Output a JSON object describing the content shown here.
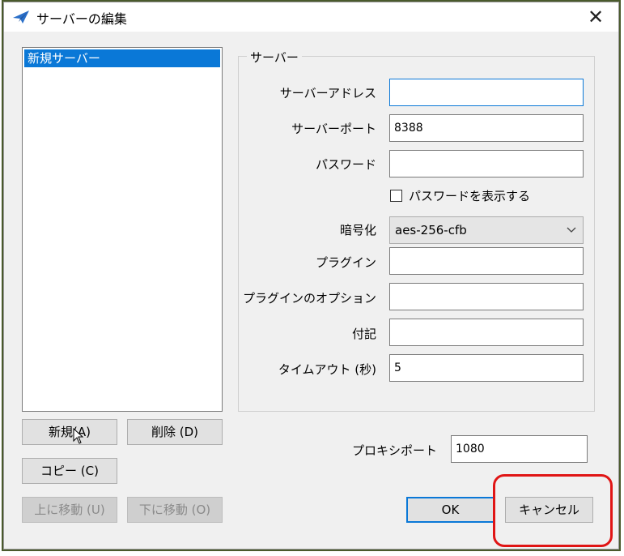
{
  "window": {
    "title": "サーバーの編集",
    "close_glyph": "✕",
    "icon": "paper-plane-icon"
  },
  "server_list": {
    "items": [
      "新規サーバー"
    ],
    "selected_index": 0
  },
  "left_buttons": {
    "new_label": "新規(A)",
    "delete_label": "削除 (D)",
    "copy_label": "コピー (C)",
    "move_up_label": "上に移動 (U)",
    "move_down_label": "下に移動 (O)"
  },
  "server_group": {
    "title": "サーバー",
    "fields": {
      "address": {
        "label": "サーバーアドレス",
        "value": ""
      },
      "port": {
        "label": "サーバーポート",
        "value": "8388"
      },
      "password": {
        "label": "パスワード",
        "value": ""
      },
      "show_password": {
        "label": "パスワードを表示する",
        "checked": false
      },
      "encryption": {
        "label": "暗号化",
        "value": "aes-256-cfb"
      },
      "plugin": {
        "label": "プラグイン",
        "value": ""
      },
      "plugin_options": {
        "label": "プラグインのオプション",
        "value": ""
      },
      "remarks": {
        "label": "付記",
        "value": ""
      },
      "timeout": {
        "label": "タイムアウト (秒)",
        "value": "5"
      }
    }
  },
  "proxy": {
    "label": "プロキシポート",
    "value": "1080"
  },
  "footer": {
    "ok_label": "OK",
    "cancel_label": "キャンセル"
  },
  "colors": {
    "selection": "#0a78d7",
    "highlight": "#e01515",
    "dialog_bg": "#f0f0f0"
  }
}
